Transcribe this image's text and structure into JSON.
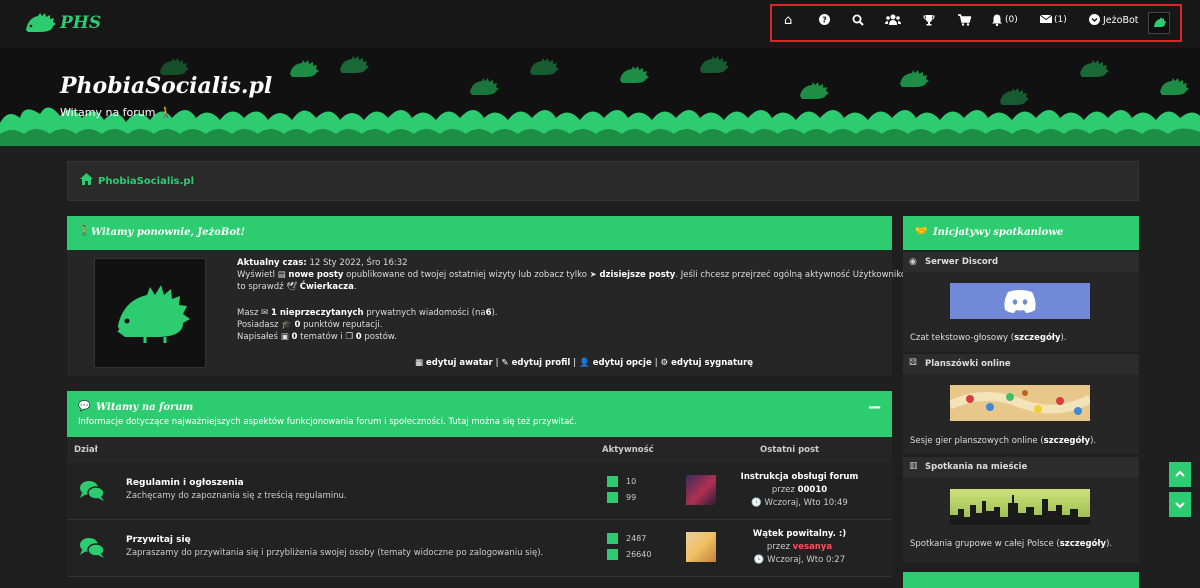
{
  "nav": {
    "logo_text": "PHS",
    "items": [
      {
        "name": "home",
        "icon": "home-icon",
        "glyph": "⌂"
      },
      {
        "name": "help",
        "icon": "question-icon",
        "glyph": "?"
      },
      {
        "name": "search",
        "icon": "search-icon",
        "glyph": "⚲"
      },
      {
        "name": "members",
        "icon": "users-icon",
        "glyph": "👥"
      },
      {
        "name": "trophy",
        "icon": "trophy-icon",
        "glyph": "🏆"
      },
      {
        "name": "shop",
        "icon": "cart-icon",
        "glyph": "🛒"
      }
    ],
    "notifications_count": "(0)",
    "messages_count": "(1)",
    "username": "JeżoBot"
  },
  "banner": {
    "title": "PhobiaSocialis.pl",
    "subtitle": "Witamy na forum"
  },
  "breadcrumb": {
    "label": "PhobiaSocialis.pl"
  },
  "welcome": {
    "title": "Witamy ponownie, JeżoBot!",
    "time_label": "Aktualny czas:",
    "time_value": "12 Sty 2022, Śro 16:32",
    "line2a": "Wyświetl",
    "new_posts": "nowe posty",
    "line2b": "opublikowane od twojej ostatniej wizyty lub zobacz tylko",
    "today_posts": "dzisiejsze posty",
    "line2c": ". Jeśli chcesz przejrzeć ogólną aktywność Użytkowników,",
    "line3a": "to sprawdź",
    "chirper": "Ćwierkacza",
    "line3b": ".",
    "msg_a": "Masz",
    "msg_b": "1 nieprzeczytanych",
    "msg_c": "prywatnych wiadomości (na",
    "msg_total": "6",
    "msg_d": ").",
    "rep_a": "Posiadasz",
    "rep_b": "0",
    "rep_c": "punktów reputacji.",
    "wrote_a": "Napisałeś",
    "wrote_topics": "0",
    "wrote_b": "tematów i",
    "wrote_posts": "0",
    "wrote_c": "postów.",
    "edit_links": [
      "edytuj awatar",
      "edytuj profil",
      "edytuj opcje",
      "edytuj sygnaturę"
    ],
    "sep": "|"
  },
  "forum": {
    "title": "Witamy na forum",
    "description": "Informacje dotyczące najważniejszych aspektów funkcjonowania forum i społeczności. Tutaj można się też przywitać.",
    "collapse_label": "−",
    "columns": {
      "section": "Dział",
      "activity": "Aktywność",
      "last_post": "Ostatni post"
    },
    "rows": [
      {
        "title": "Regulamin i ogłoszenia",
        "desc": "Zachęcamy do zapoznania się z treścią regulaminu.",
        "topics": "10",
        "posts": "99",
        "last_title": "Instrukcja obsługi forum",
        "by": "przez",
        "author": "00010",
        "author_color": "#ffffff",
        "when": "Wczoraj, Wto 10:49"
      },
      {
        "title": "Przywitaj się",
        "desc": "Zapraszamy do przywitania się i przybliżenia swojej osoby (tematy widoczne po zalogowaniu się).",
        "topics": "2487",
        "posts": "26640",
        "last_title": "Wątek powitalny. :)",
        "by": "przez",
        "author": "vesanya",
        "author_color": "#ff4d5a",
        "when": "Wczoraj, Wto 0:27"
      }
    ]
  },
  "sidebar": {
    "title": "Inicjatywy spotkaniowe",
    "sections": [
      {
        "label": "Serwer Discord",
        "icon": "discord-icon",
        "caption_a": "Czat tekstowo-głosowy (",
        "caption_link": "szczegóły",
        "caption_b": ")."
      },
      {
        "label": "Planszówki online",
        "icon": "dice-icon",
        "caption_a": "Sesje gier planszowych online (",
        "caption_link": "szczegóły",
        "caption_b": ")."
      },
      {
        "label": "Spotkania na mieście",
        "icon": "city-icon",
        "caption_a": "Spotkania grupowe w całej Polsce (",
        "caption_link": "szczegóły",
        "caption_b": ")."
      }
    ]
  },
  "colors": {
    "accent": "#2ecc71",
    "highlight": "#e02424",
    "discord": "#7289da"
  }
}
